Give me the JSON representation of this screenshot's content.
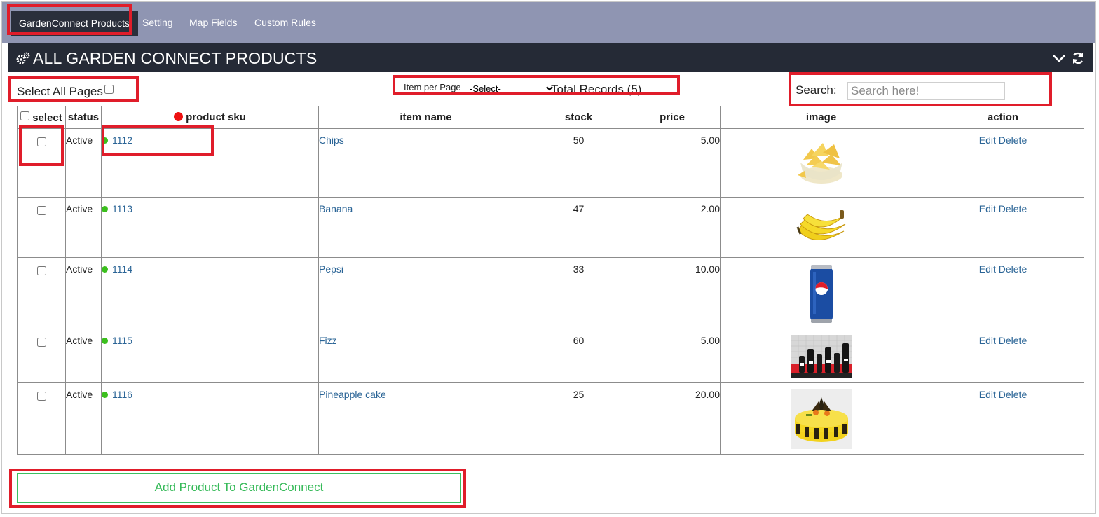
{
  "nav": {
    "tabs": [
      {
        "label": "GardenConnect Products"
      },
      {
        "label": "Setting"
      },
      {
        "label": "Map Fields"
      },
      {
        "label": "Custom Rules"
      }
    ]
  },
  "panel": {
    "title": "ALL GARDEN CONNECT PRODUCTS"
  },
  "controls": {
    "select_all_label": "Select All Pages",
    "items_per_page_label": "Item per Page",
    "items_per_page_value": "-Select-",
    "total_records": "Total Records (5)",
    "search_label": "Search:",
    "search_placeholder": "Search here!"
  },
  "table": {
    "headers": [
      "select",
      "status",
      "product sku",
      "item name",
      "stock",
      "price",
      "image",
      "action"
    ],
    "rows": [
      {
        "status": "Active",
        "sku": "1112",
        "name": "Chips",
        "stock": "50",
        "price": "5.00",
        "edit": "Edit",
        "delete": "Delete",
        "image": "chips"
      },
      {
        "status": "Active",
        "sku": "1113",
        "name": "Banana",
        "stock": "47",
        "price": "2.00",
        "edit": "Edit",
        "delete": "Delete",
        "image": "banana"
      },
      {
        "status": "Active",
        "sku": "1114",
        "name": "Pepsi",
        "stock": "33",
        "price": "10.00",
        "edit": "Edit",
        "delete": "Delete",
        "image": "pepsi-can"
      },
      {
        "status": "Active",
        "sku": "1115",
        "name": "Fizz",
        "stock": "60",
        "price": "5.00",
        "edit": "Edit",
        "delete": "Delete",
        "image": "fizz-bottles"
      },
      {
        "status": "Active",
        "sku": "1116",
        "name": "Pineapple cake",
        "stock": "25",
        "price": "20.00",
        "edit": "Edit",
        "delete": "Delete",
        "image": "pineapple-cake"
      }
    ]
  },
  "footer": {
    "add_button": "Add Product To GardenConnect"
  },
  "colors": {
    "nav_bg": "#8f95b2",
    "title_bg": "#252a36",
    "link": "#2a6496",
    "status_dot": "#3bbf1d",
    "highlight": "#e01d2a",
    "add_button": "#34b957"
  }
}
